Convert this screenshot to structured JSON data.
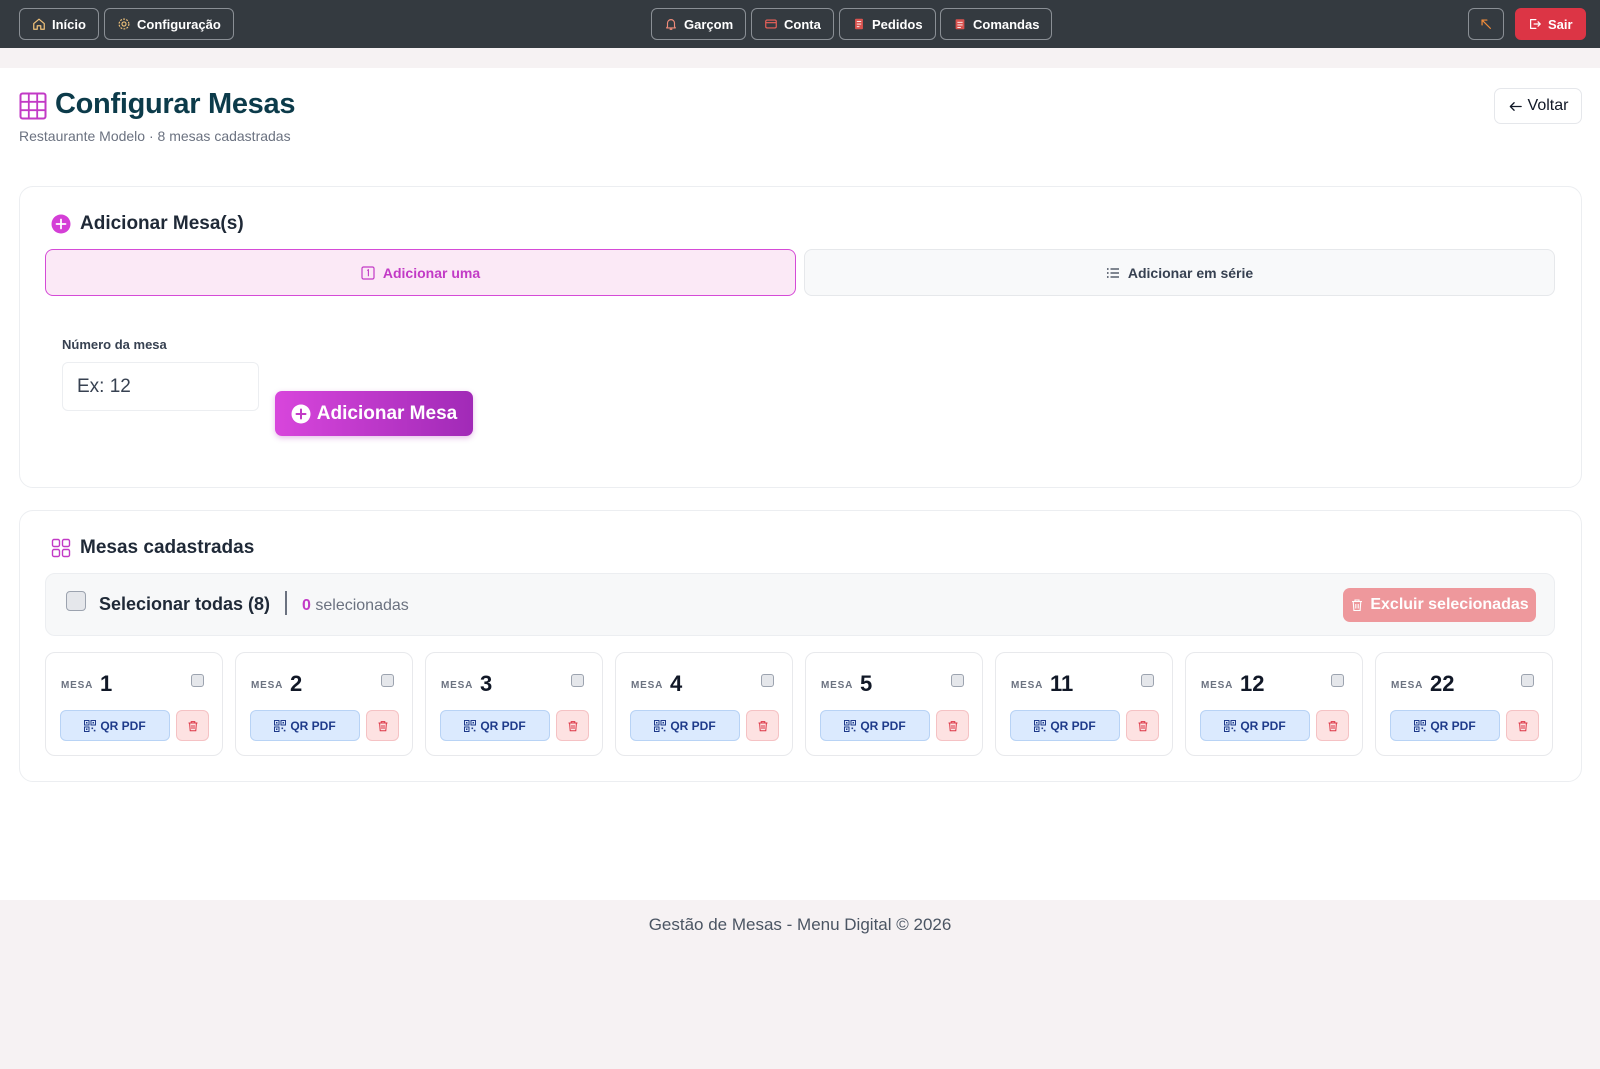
{
  "nav": {
    "left": [
      {
        "label": "Início",
        "icon": "home-icon"
      },
      {
        "label": "Configuração",
        "icon": "gear-icon"
      }
    ],
    "center": [
      {
        "label": "Garçom",
        "icon": "bell-icon"
      },
      {
        "label": "Conta",
        "icon": "wallet-icon"
      },
      {
        "label": "Pedidos",
        "icon": "receipt-icon"
      },
      {
        "label": "Comandas",
        "icon": "clipboard-icon"
      }
    ],
    "exit_label": "Sair"
  },
  "header": {
    "title": "Configurar Mesas",
    "subtitle": "Restaurante Modelo · 8 mesas cadastradas",
    "back_label": "Voltar"
  },
  "add_section": {
    "title": "Adicionar Mesa(s)",
    "tab_one": "Adicionar uma",
    "tab_series": "Adicionar em série",
    "field_label": "Número da mesa",
    "field_placeholder": "Ex: 12",
    "submit_label": "Adicionar Mesa"
  },
  "list_section": {
    "title": "Mesas cadastradas",
    "select_all_label": "Selecionar todas (8)",
    "selected_count": "0",
    "selected_suffix": "selecionadas",
    "delete_selected_label": "Excluir selecionadas",
    "mesa_tag": "MESA",
    "qr_label": "QR PDF",
    "mesas": [
      "1",
      "2",
      "3",
      "4",
      "5",
      "11",
      "12",
      "22"
    ]
  },
  "footer": {
    "text": "Gestão de Mesas - Menu Digital © 2026"
  },
  "colors": {
    "topbar": "#343a40",
    "accent": "#c23ac6",
    "title": "#0c3b4a",
    "danger": "#dc3545"
  }
}
